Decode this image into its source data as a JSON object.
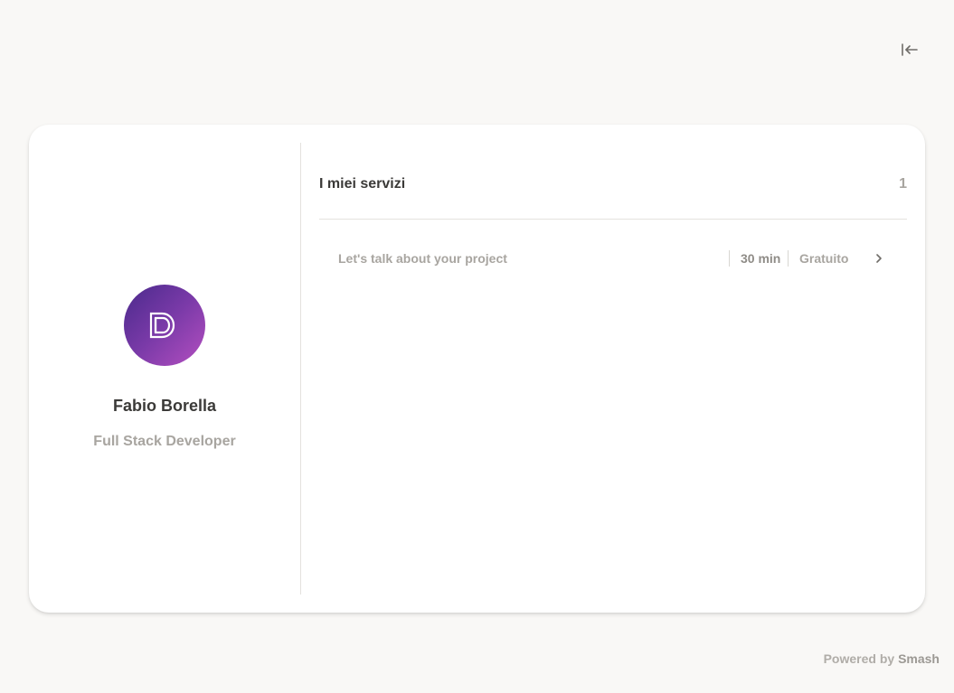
{
  "header": {
    "collapse_icon": "collapse-left-icon"
  },
  "profile": {
    "avatar_icon": "dd-logo-icon",
    "name": "Fabio Borella",
    "role": "Full Stack Developer"
  },
  "services": {
    "title": "I miei servizi",
    "count": "1",
    "items": [
      {
        "name": "Let's talk about your project",
        "duration": "30 min",
        "price": "Gratuito",
        "icon": "chevron-right-icon"
      }
    ]
  },
  "footer": {
    "powered_prefix": "Powered by",
    "brand": "Smash"
  },
  "colors": {
    "background": "#f9f8f6",
    "card": "#ffffff",
    "avatar_gradient_start": "#4a2a8c",
    "avatar_gradient_end": "#b44fc0",
    "text_dark": "#3b3a38",
    "text_muted": "#a8a5a0"
  }
}
